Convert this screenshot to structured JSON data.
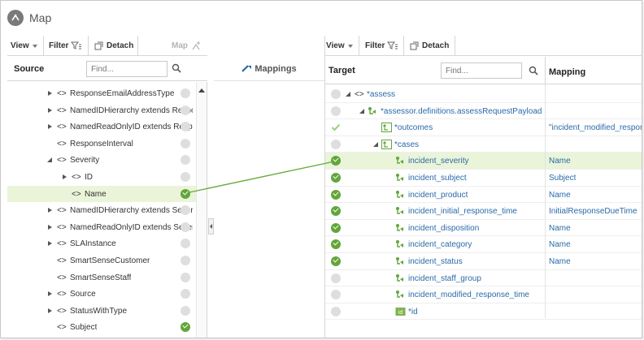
{
  "title": "Map",
  "source_panel": {
    "toolbar": {
      "view": "View",
      "filter": "Filter",
      "detach": "Detach",
      "map": "Map"
    },
    "header": "Source",
    "find_placeholder": "Find...",
    "rows": [
      {
        "label": "ResponseEmailAddressType",
        "type_glyph": "<>",
        "expander": "right",
        "indent": 0,
        "mapped": false,
        "selected": false
      },
      {
        "label": "NamedIDHierarchy extends Respons",
        "type_glyph": "<>",
        "expander": "right",
        "indent": 0,
        "mapped": false,
        "selected": false
      },
      {
        "label": "NamedReadOnlyID extends Respons",
        "type_glyph": "<>",
        "expander": "right",
        "indent": 0,
        "mapped": false,
        "selected": false
      },
      {
        "label": "ResponseInterval",
        "type_glyph": "<>",
        "expander": "none",
        "indent": 0,
        "mapped": false,
        "selected": false
      },
      {
        "label": "Severity",
        "type_glyph": "<>",
        "expander": "down",
        "indent": 0,
        "mapped": false,
        "selected": false
      },
      {
        "label": "ID",
        "type_glyph": "<>",
        "expander": "right",
        "indent": 1,
        "mapped": false,
        "selected": false
      },
      {
        "label": "Name",
        "type_glyph": "<>",
        "expander": "none",
        "indent": 1,
        "mapped": true,
        "selected": true
      },
      {
        "label": "NamedIDHierarchy extends Severity",
        "type_glyph": "<>",
        "expander": "right",
        "indent": 0,
        "mapped": false,
        "selected": false
      },
      {
        "label": "NamedReadOnlyID extends Severity",
        "type_glyph": "<>",
        "expander": "right",
        "indent": 0,
        "mapped": false,
        "selected": false
      },
      {
        "label": "SLAInstance",
        "type_glyph": "<>",
        "expander": "right",
        "indent": 0,
        "mapped": false,
        "selected": false
      },
      {
        "label": "SmartSenseCustomer",
        "type_glyph": "<>",
        "expander": "none",
        "indent": 0,
        "mapped": false,
        "selected": false
      },
      {
        "label": "SmartSenseStaff",
        "type_glyph": "<>",
        "expander": "none",
        "indent": 0,
        "mapped": false,
        "selected": false
      },
      {
        "label": "Source",
        "type_glyph": "<>",
        "expander": "right",
        "indent": 0,
        "mapped": false,
        "selected": false
      },
      {
        "label": "StatusWithType",
        "type_glyph": "<>",
        "expander": "right",
        "indent": 0,
        "mapped": false,
        "selected": false
      },
      {
        "label": "Subject",
        "type_glyph": "<>",
        "expander": "none",
        "indent": 0,
        "mapped": true,
        "selected": false
      }
    ]
  },
  "mappings_panel": {
    "header": "Mappings"
  },
  "target_panel": {
    "toolbar": {
      "view": "View",
      "filter": "Filter",
      "detach": "Detach"
    },
    "header": "Target",
    "find_placeholder": "Find...",
    "mapping_header": "Mapping",
    "rows": [
      {
        "label": "*assess",
        "type": "element",
        "expander": "down",
        "indent": 0,
        "status": "none",
        "mapping": "",
        "selected": false
      },
      {
        "label": "*assessor.definitions.assessRequestPayload",
        "type": "complex",
        "expander": "down",
        "indent": 1,
        "status": "none",
        "mapping": "",
        "selected": false
      },
      {
        "label": "*outcomes",
        "type": "complex-list",
        "expander": "none",
        "indent": 2,
        "status": "check",
        "mapping": "\"incident_modified_respon",
        "selected": false
      },
      {
        "label": "*cases",
        "type": "complex-list",
        "expander": "down",
        "indent": 2,
        "status": "none",
        "mapping": "",
        "selected": false
      },
      {
        "label": "incident_severity",
        "type": "field",
        "expander": "none",
        "indent": 3,
        "status": "mapped",
        "mapping": "Name",
        "selected": true
      },
      {
        "label": "incident_subject",
        "type": "field",
        "expander": "none",
        "indent": 3,
        "status": "mapped",
        "mapping": "Subject",
        "selected": false
      },
      {
        "label": "incident_product",
        "type": "field",
        "expander": "none",
        "indent": 3,
        "status": "mapped",
        "mapping": "Name",
        "selected": false
      },
      {
        "label": "incident_initial_response_time",
        "type": "field",
        "expander": "none",
        "indent": 3,
        "status": "mapped",
        "mapping": "InitialResponseDueTime",
        "selected": false
      },
      {
        "label": "incident_disposition",
        "type": "field",
        "expander": "none",
        "indent": 3,
        "status": "mapped",
        "mapping": "Name",
        "selected": false
      },
      {
        "label": "incident_category",
        "type": "field",
        "expander": "none",
        "indent": 3,
        "status": "mapped",
        "mapping": "Name",
        "selected": false
      },
      {
        "label": "incident_status",
        "type": "field",
        "expander": "none",
        "indent": 3,
        "status": "mapped",
        "mapping": "Name",
        "selected": false
      },
      {
        "label": "incident_staff_group",
        "type": "field",
        "expander": "none",
        "indent": 3,
        "status": "none",
        "mapping": "",
        "selected": false
      },
      {
        "label": "incident_modified_response_time",
        "type": "field",
        "expander": "none",
        "indent": 3,
        "status": "none",
        "mapping": "",
        "selected": false
      },
      {
        "label": "*id",
        "type": "id-field",
        "expander": "none",
        "indent": 3,
        "status": "none",
        "mapping": "",
        "selected": false
      }
    ]
  },
  "colors": {
    "mapped_green": "#62a63b",
    "link_blue": "#2a6aa8",
    "selected_row": "#eaf4d9",
    "mapping_line": "#6aab3c",
    "unmapped_gray": "#dedede"
  },
  "icons": {
    "title": "map-icon",
    "view_dropdown": "chevron-down-icon",
    "filter": "filter-icon",
    "detach": "detach-icon",
    "map": "map-add-icon",
    "find": "search-icon",
    "mappings": "mappings-icon",
    "collapse_handle": "chevron-left-icon"
  }
}
